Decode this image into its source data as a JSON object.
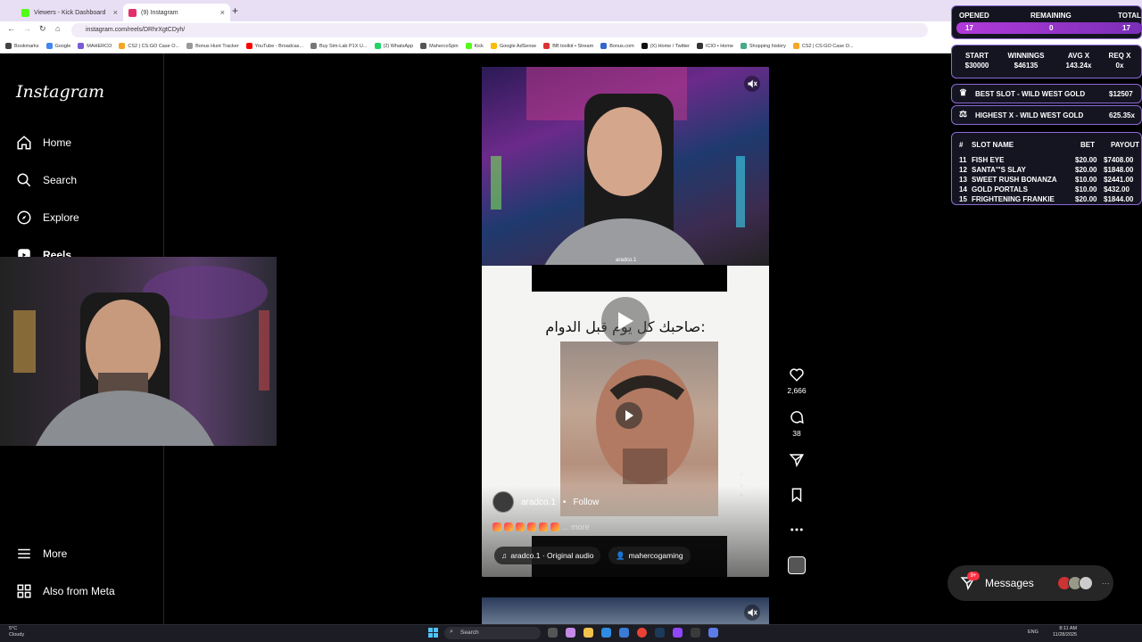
{
  "browser": {
    "tabs": [
      {
        "title": "Viewers - Kick Dashboard",
        "color": "#53fc18"
      },
      {
        "title": "(9) Instagram",
        "color": "#e1306c"
      }
    ],
    "url": "instagram.com/reels/DRhrXgtCDyh/",
    "bookmarks": [
      {
        "label": "Bookmarks",
        "color": "#444"
      },
      {
        "label": "Google",
        "color": "#4285f4"
      },
      {
        "label": "MAHERCO",
        "color": "#7a5bd6"
      },
      {
        "label": "CS2 | CS:GO Case O...",
        "color": "#f5a623"
      },
      {
        "label": "Bonus Hunt Tracker",
        "color": "#999"
      },
      {
        "label": "YouTube - Broadcas...",
        "color": "#ff0000"
      },
      {
        "label": "Buy Sim-Lab P1X U...",
        "color": "#777"
      },
      {
        "label": "(2) WhatsApp",
        "color": "#25d366"
      },
      {
        "label": "MahercoSpin",
        "color": "#555"
      },
      {
        "label": "Kick",
        "color": "#53fc18"
      },
      {
        "label": "Google AdSense",
        "color": "#fbbc05"
      },
      {
        "label": "BB toolkit • Stream",
        "color": "#d33"
      },
      {
        "label": "Bonus.com",
        "color": "#36c"
      },
      {
        "label": "(X) Home / Twitter",
        "color": "#111"
      },
      {
        "label": "ICIO • Home",
        "color": "#333"
      },
      {
        "label": "Shopping history",
        "color": "#4a8"
      },
      {
        "label": "CS2 | CS:GO Case O...",
        "color": "#f5a623"
      }
    ]
  },
  "sidebar": {
    "logo": "Instagram",
    "nav": [
      {
        "label": "Home",
        "icon": "home-icon"
      },
      {
        "label": "Search",
        "icon": "search-icon"
      },
      {
        "label": "Explore",
        "icon": "explore-icon"
      },
      {
        "label": "Reels",
        "icon": "reels-icon"
      }
    ],
    "bottom": [
      {
        "label": "More",
        "icon": "menu-icon"
      },
      {
        "label": "Also from Meta",
        "icon": "meta-icon"
      }
    ]
  },
  "reel": {
    "caption_arabic": "صاحبك كل يوم قبل الدوام:",
    "watermark": "aradco.1",
    "author": "aradco.1",
    "follow_label": "Follow",
    "separator": "•",
    "more_label": "... more",
    "audio_label": "aradco.1 · Original audio",
    "tagged_user": "mahercogaming",
    "likes": "2,666",
    "comments": "38"
  },
  "messages": {
    "label": "Messages",
    "badge": "9+",
    "more": "···"
  },
  "overlay": {
    "opened_label": "OPENED",
    "remaining_label": "REMAINING",
    "total_label": "TOTAL",
    "opened": "17",
    "remaining": "0",
    "total": "17",
    "start_label": "START",
    "winnings_label": "WINNINGS",
    "avgx_label": "AVG X",
    "reqx_label": "REQ X",
    "start": "$30000",
    "winnings": "$46135",
    "avgx": "143.24x",
    "reqx": "0x",
    "best_slot_label": "BEST SLOT - WILD WEST GOLD",
    "best_slot_value": "$12507",
    "highest_x_label": "HIGHEST X - WILD WEST GOLD",
    "highest_x_value": "625.35x",
    "table_headers": {
      "num": "#",
      "name": "SLOT NAME",
      "bet": "BET",
      "payout": "PAYOUT"
    },
    "rows": [
      {
        "num": "11",
        "name": "FISH EYE",
        "bet": "$20.00",
        "payout": "$7408.00"
      },
      {
        "num": "12",
        "name": "SANTA'\"S SLAY",
        "bet": "$20.00",
        "payout": "$1848.00"
      },
      {
        "num": "13",
        "name": "SWEET RUSH BONANZA",
        "bet": "$10.00",
        "payout": "$2441.00"
      },
      {
        "num": "14",
        "name": "GOLD PORTALS",
        "bet": "$10.00",
        "payout": "$432.00"
      },
      {
        "num": "15",
        "name": "FRIGHTENING FRANKIE",
        "bet": "$20.00",
        "payout": "$1844.00"
      }
    ]
  },
  "taskbar": {
    "weather_temp": "5°C",
    "weather_desc": "Cloudy",
    "search": "Search",
    "lang": "ENG",
    "time": "8:11 AM",
    "date": "11/28/2025"
  }
}
